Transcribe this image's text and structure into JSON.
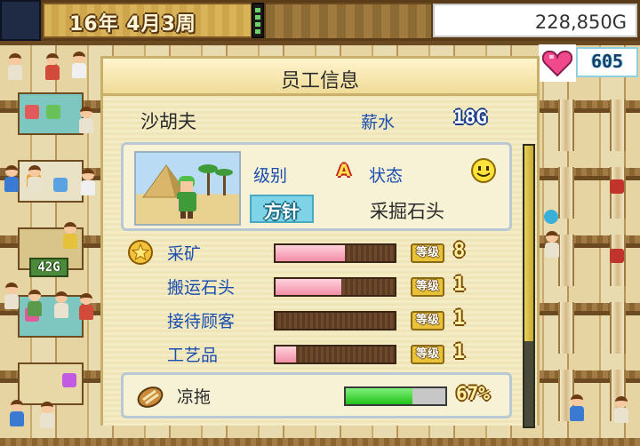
{
  "top_bar": {
    "date": "16年 4月3周",
    "money": "228,850G"
  },
  "popularity": {
    "icon": "heart-icon",
    "value": "605"
  },
  "shop_sign": {
    "price": "42G"
  },
  "dialog": {
    "title": "员工信息",
    "employee_name": "沙胡夫",
    "salary_label": "薪水",
    "salary_value": "18G",
    "rank_label": "级别",
    "rank_value": "A",
    "status_label": "状态",
    "status_icon": "smiley-face-icon",
    "policy_button": "方针",
    "current_task": "采掘石头",
    "level_tag": "等级",
    "skills": [
      {
        "name": "采矿",
        "level": "8",
        "progress": 0.58,
        "starred": true
      },
      {
        "name": "搬运石头",
        "level": "1",
        "progress": 0.55,
        "starred": false
      },
      {
        "name": "接待顾客",
        "level": "1",
        "progress": 0.0,
        "starred": false
      },
      {
        "name": "工艺品",
        "level": "1",
        "progress": 0.17,
        "starred": false
      }
    ],
    "equipment": {
      "icon": "sandal-icon",
      "name": "凉拖",
      "percent": "67%",
      "progress": 0.67
    }
  },
  "colors": {
    "dialog_bg": "#f4ecc4",
    "label_blue": "#1a4fb0",
    "skill_fill": "#f28ea6",
    "equip_fill": "#22c21a",
    "popularity_border": "#8fd0e0"
  }
}
